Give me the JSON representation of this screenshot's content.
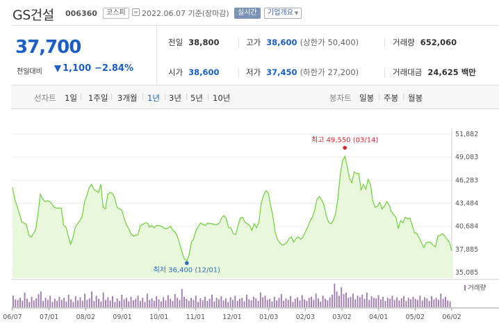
{
  "header": {
    "stock_name": "GS건설",
    "stock_code": "006360",
    "market_badge": "코스피",
    "date_text": "2022.06.07 기준(장마감)",
    "realtime_badge": "실시간",
    "company_info_button": "기업개요"
  },
  "summary": {
    "price": "37,700",
    "change_label": "전일대비",
    "change_value": "1,100",
    "change_rate": "−2.84%",
    "change_direction": "down"
  },
  "stats": {
    "prev_close_label": "전일",
    "prev_close": "38,800",
    "high_label": "고가",
    "high": "38,600",
    "upper_limit": "(상한가 50,400)",
    "volume_label": "거래량",
    "volume": "652,060",
    "open_label": "시가",
    "open": "38,600",
    "low_label": "저가",
    "low": "37,450",
    "lower_limit": "(하한가 27,200)",
    "amount_label": "거래대금",
    "amount": "24,625 백만"
  },
  "period_bar": {
    "line_chart_label": "선차트",
    "periods": [
      "1일",
      "1주일",
      "3개월",
      "1년",
      "3년",
      "5년",
      "10년"
    ],
    "active_period": "1년",
    "candle_chart_label": "봉차트",
    "candle_periods": [
      "일봉",
      "주봉",
      "월봉"
    ]
  },
  "colors": {
    "down_blue": "#1b5ec5",
    "line_green": "#6ccf3a",
    "fill_green": "#e9f8dc",
    "volume_purple": "#a07bb0",
    "max_marker": "#e0202b",
    "min_marker": "#2a6fc4"
  },
  "chart_data": {
    "type": "area",
    "y_ticks": [
      "51,882",
      "49,083",
      "46,283",
      "43,484",
      "40,684",
      "37,885",
      "35,085"
    ],
    "ylim": [
      35085,
      51882
    ],
    "x_ticks": [
      "06/07",
      "07/01",
      "08/02",
      "09/01",
      "10/01",
      "11/01",
      "12/01",
      "01/03",
      "02/03",
      "03/02",
      "04/01",
      "05/02",
      "06/02"
    ],
    "max_annotation": "최고 49,550 (03/14)",
    "min_annotation": "최저 36,400 (12/01)",
    "max_point": {
      "date": "03/14",
      "value": 49550
    },
    "min_point": {
      "date": "12/01",
      "value": 36400
    },
    "volume_legend": "거래량",
    "price_series": [
      45400,
      44000,
      43100,
      42200,
      41200,
      41100,
      40900,
      39600,
      39400,
      39800,
      40300,
      42300,
      44600,
      44000,
      43700,
      43800,
      43700,
      43400,
      43000,
      42900,
      42900,
      42900,
      40800,
      40600,
      39500,
      38500,
      39300,
      40600,
      41000,
      41400,
      41900,
      43700,
      44400,
      45400,
      45800,
      45200,
      45000,
      44800,
      45800,
      43000,
      42800,
      44600,
      44800,
      44700,
      44100,
      43000,
      42800,
      42700,
      41700,
      40900,
      40400,
      39800,
      39500,
      39600,
      39700,
      40800,
      40900,
      41100,
      41100,
      40600,
      40800,
      40500,
      40800,
      40800,
      40700,
      40500,
      40400,
      40500,
      40700,
      40200,
      40000,
      39400,
      38500,
      37500,
      36700,
      36500,
      37200,
      38800,
      39200,
      40200,
      40700,
      41100,
      40900,
      40800,
      41100,
      41000,
      41000,
      40900,
      40900,
      41100,
      41700,
      42000,
      41600,
      40500,
      40500,
      39800,
      39700,
      40700,
      41700,
      41800,
      41200,
      41000,
      40800,
      40200,
      41000,
      40500,
      41200,
      43500,
      44400,
      45000,
      44800,
      43300,
      42000,
      40000,
      39100,
      38700,
      38400,
      38500,
      38700,
      39200,
      39400,
      38800,
      39200,
      39400,
      39100,
      39400,
      40000,
      40600,
      41300,
      41800,
      42600,
      44000,
      44300,
      43900,
      43300,
      42000,
      41200,
      41000,
      41400,
      42200,
      44000,
      46900,
      48600,
      49200,
      48000,
      46500,
      46000,
      47300,
      47100,
      47100,
      45100,
      45800,
      45200,
      46400,
      45800,
      43800,
      43000,
      43100,
      43600,
      42800,
      43100,
      43700,
      43300,
      42500,
      42100,
      41800,
      40400,
      41400,
      41100,
      41800,
      41600,
      41700,
      40800,
      39900,
      39800,
      39300,
      38700,
      38100,
      38700,
      38800,
      38700,
      38400,
      38200,
      39500,
      39600,
      39800,
      39500,
      39100,
      38800,
      37700
    ],
    "volume_series": [
      22,
      15,
      14,
      18,
      12,
      28,
      16,
      10,
      20,
      13,
      17,
      25,
      30,
      12,
      18,
      14,
      22,
      10,
      16,
      12,
      20,
      14,
      18,
      11,
      24,
      15,
      10,
      21,
      13,
      19,
      12,
      26,
      14,
      17,
      30,
      12,
      22,
      16,
      11,
      28,
      14,
      19,
      13,
      21,
      10,
      17,
      12,
      24,
      15,
      18,
      11,
      20,
      13,
      16,
      22,
      12,
      18,
      10,
      26,
      14,
      17,
      12,
      21,
      15,
      11,
      19,
      13,
      23,
      16,
      12,
      25,
      18,
      14,
      35,
      20,
      16,
      12,
      18,
      14,
      22,
      10,
      17,
      13,
      20,
      12,
      16,
      24,
      11,
      18,
      15,
      21,
      13,
      17,
      10,
      19,
      14,
      22,
      12,
      16,
      18,
      11,
      24,
      15,
      13,
      20,
      17,
      12,
      28,
      19,
      22,
      14,
      16,
      11,
      20,
      13,
      18,
      25,
      12,
      17,
      14,
      21,
      10,
      16,
      19,
      13,
      23,
      15,
      12,
      18,
      20,
      14,
      26,
      17,
      11,
      22,
      16,
      13,
      19,
      24,
      45,
      30,
      22,
      38,
      25,
      28,
      18,
      20,
      26,
      15,
      22,
      19,
      24,
      16,
      28,
      14,
      21,
      18,
      17,
      23,
      15,
      20,
      12,
      18,
      16,
      22,
      14,
      19,
      13,
      17,
      21,
      12,
      18,
      15,
      20,
      16,
      14,
      22,
      13,
      19,
      17,
      12,
      21,
      15,
      18,
      14,
      26,
      16,
      20,
      13,
      11
    ]
  }
}
